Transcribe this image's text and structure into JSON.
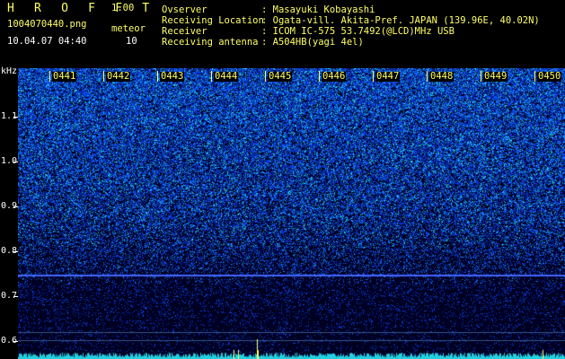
{
  "header": {
    "app_name": "H R O F F T",
    "version": "1.00",
    "filename": "1004070440.png",
    "datetime": "10.04.07 04:40",
    "meteor_label": "meteor",
    "meteor_count": "10",
    "rows": [
      {
        "label": "Ovserver",
        "value": ": Masayuki Kobayashi"
      },
      {
        "label": "Receiving Location",
        "value": ": Ogata-vill. Akita-Pref. JAPAN (139.96E, 40.02N)"
      },
      {
        "label": "Receiver",
        "value": ": ICOM IC-575 53.7492(@LCD)MHz USB"
      },
      {
        "label": "Receiving antenna",
        "value": ": A504HB(yagi 4el)"
      }
    ]
  },
  "axis": {
    "unit": "kHz",
    "y_labels": [
      "1.1",
      "1.0",
      "0.9",
      "0.8",
      "0.7",
      "0.6"
    ],
    "x_labels": [
      "0441",
      "0442",
      "0443",
      "0444",
      "0445",
      "0446",
      "0447",
      "0448",
      "0449",
      "0450"
    ]
  },
  "colors": {
    "header_yellow": "#ffff66",
    "header_green": "#66ff66",
    "noise_blue": "#1a3cff",
    "noise_cyan": "#33e0e0",
    "line_blue": "#4466ff",
    "background": "#000000"
  }
}
